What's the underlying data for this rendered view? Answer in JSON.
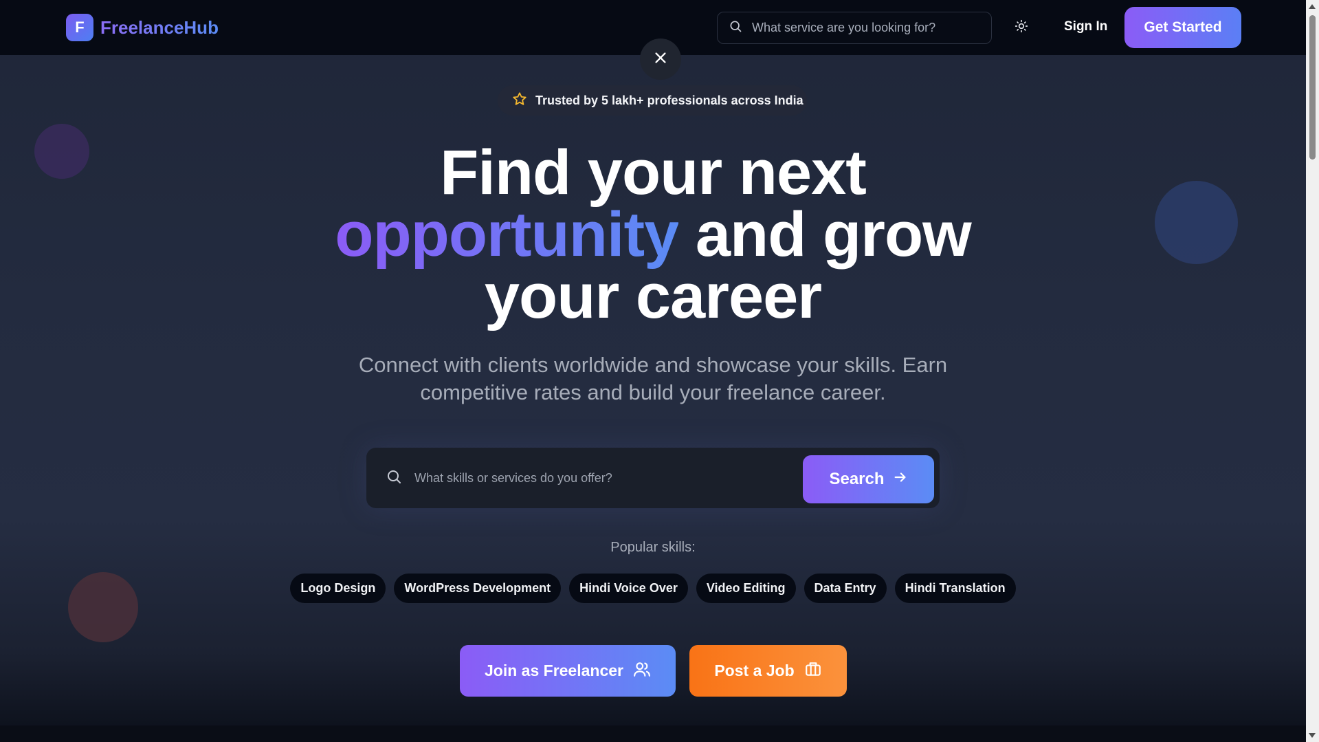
{
  "header": {
    "logo_letter": "F",
    "brand": "FreelanceHub",
    "search_placeholder": "What service are you looking for?",
    "sign_in": "Sign In",
    "get_started": "Get Started"
  },
  "hero": {
    "badge": "Trusted by 5 lakh+ professionals across India",
    "headline_line1": "Find your next",
    "headline_accent": "opportunity",
    "headline_line2_rest": " and grow",
    "headline_line3": "your career",
    "subhead": "Connect with clients worldwide and showcase your skills. Earn competitive rates and build your freelance career.",
    "search_placeholder": "What skills or services do you offer?",
    "search_button": "Search",
    "popular_label": "Popular skills:",
    "skills": [
      "Logo Design",
      "WordPress Development",
      "Hindi Voice Over",
      "Video Editing",
      "Data Entry",
      "Hindi Translation"
    ],
    "cta_freelancer": "Join as Freelancer",
    "cta_job": "Post a Job"
  },
  "colors": {
    "accent_purple": "#8b5cf6",
    "accent_blue": "#5b8cf5",
    "accent_orange": "#f97316",
    "star": "#f5b82e"
  },
  "icons": [
    "search-icon",
    "sun-icon",
    "close-icon",
    "star-icon",
    "arrow-right-icon",
    "users-icon",
    "briefcase-icon"
  ]
}
